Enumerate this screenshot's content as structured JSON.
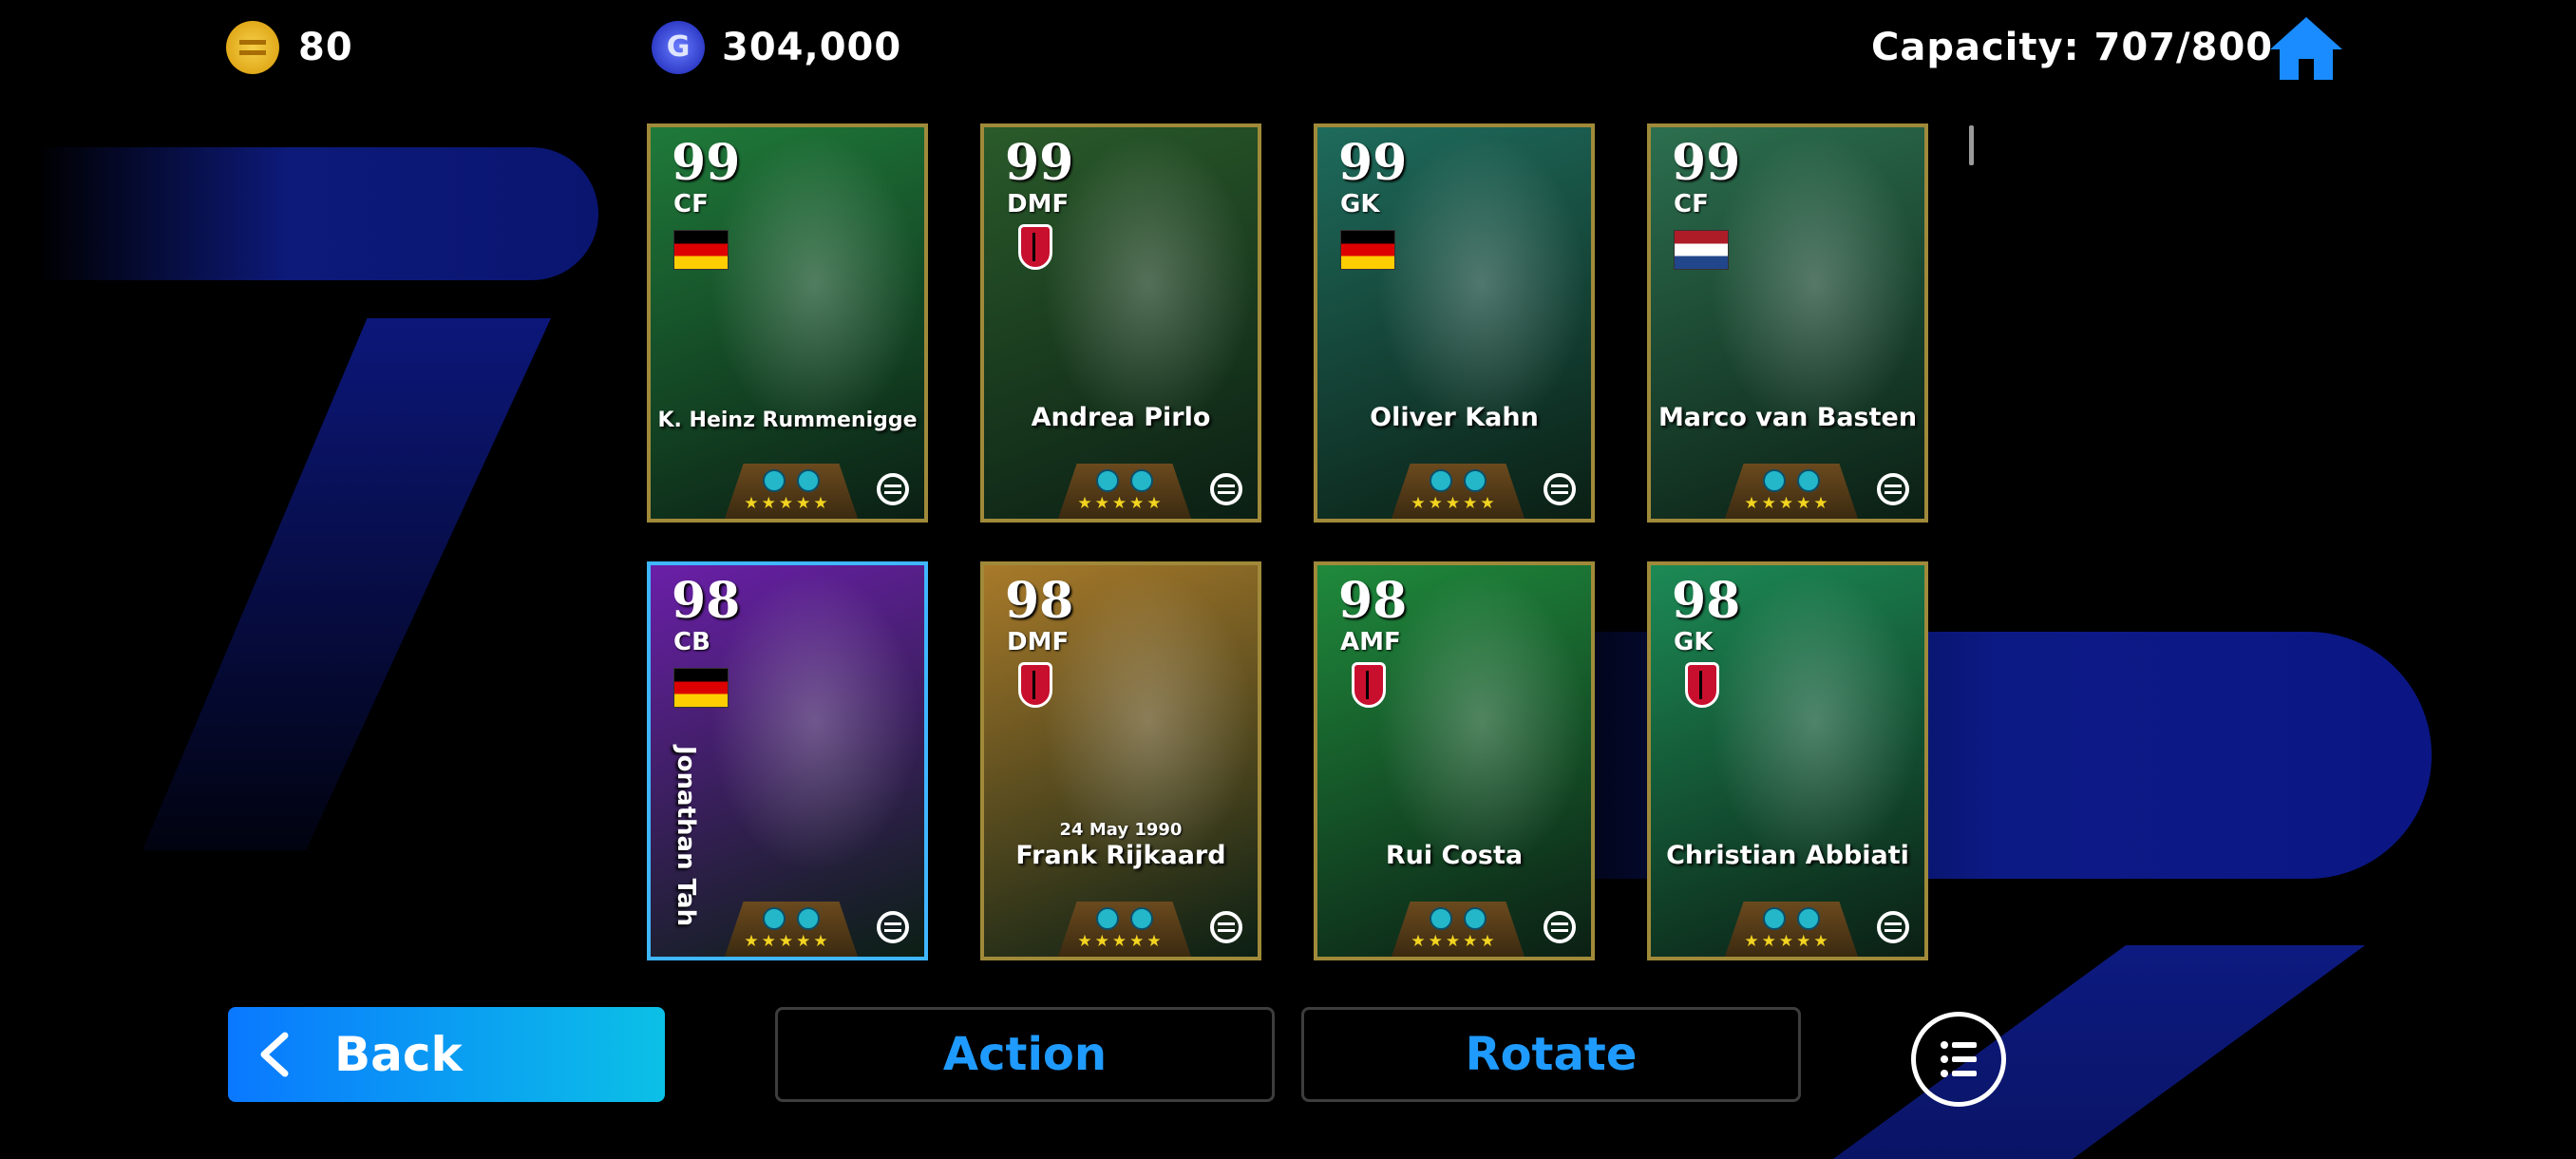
{
  "header": {
    "coins": "80",
    "gp": "304,000",
    "gp_icon_letter": "G",
    "capacity": "Capacity: 707/800",
    "icons": [
      "coin-icon",
      "gp-icon",
      "home-icon"
    ]
  },
  "cards": [
    {
      "rating": "99",
      "position": "CF",
      "name": "K. Heinz Rummenigge",
      "badge": "flag-germany",
      "stars": "★★★★★",
      "theme": "#1f7a3a"
    },
    {
      "rating": "99",
      "position": "DMF",
      "name": "Andrea Pirlo",
      "badge": "club-milan",
      "stars": "★★★★★",
      "theme": "#2a5a2a"
    },
    {
      "rating": "99",
      "position": "GK",
      "name": "Oliver Kahn",
      "badge": "flag-germany",
      "stars": "★★★★★",
      "theme": "#1e6b5c"
    },
    {
      "rating": "99",
      "position": "CF",
      "name": "Marco van Basten",
      "badge": "flag-netherlands",
      "stars": "★★★★★",
      "theme": "#2c6f4f"
    },
    {
      "rating": "98",
      "position": "CB",
      "name": "Jonathan Tah",
      "badge": "flag-germany",
      "stars": "★★★★★",
      "theme": "#6a1fa8"
    },
    {
      "rating": "98",
      "position": "DMF",
      "name": "Frank Rijkaard",
      "date": "24 May 1990",
      "badge": "club-milan",
      "stars": "★★★★★",
      "theme": "#a87a2a"
    },
    {
      "rating": "98",
      "position": "AMF",
      "name": "Rui Costa",
      "badge": "club-milan",
      "stars": "★★★★★",
      "theme": "#1f8a3c"
    },
    {
      "rating": "98",
      "position": "GK",
      "name": "Christian Abbiati",
      "badge": "club-milan",
      "stars": "★★★★★",
      "theme": "#1c8a55"
    }
  ],
  "buttons": {
    "back": "Back",
    "action": "Action",
    "rotate": "Rotate"
  },
  "colors": {
    "accent_blue": "#1f9bff",
    "back_gradient_start": "#0a78ff",
    "back_gradient_end": "#0bc0e6",
    "star_yellow": "#f2d420"
  }
}
